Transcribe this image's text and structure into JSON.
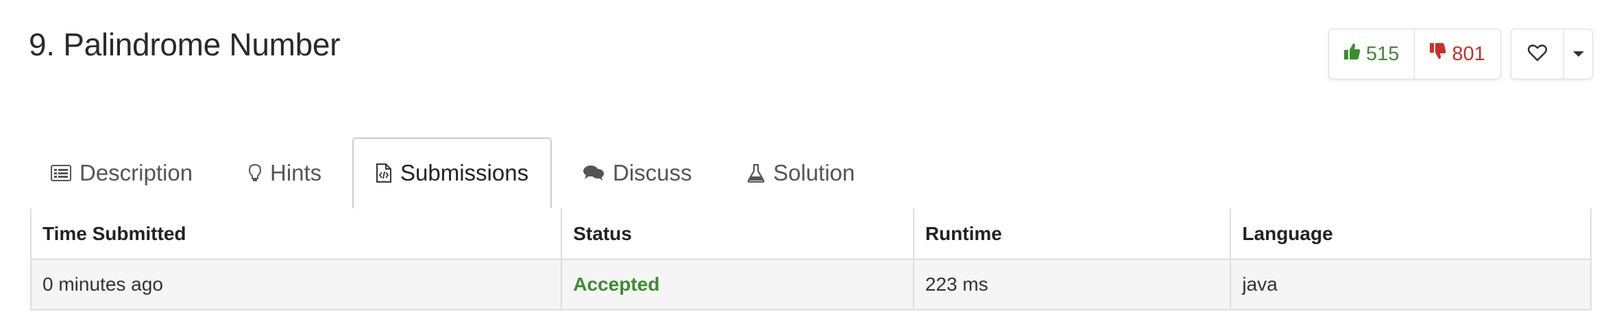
{
  "problem": {
    "title": "9. Palindrome Number"
  },
  "votes": {
    "likes": "515",
    "dislikes": "801"
  },
  "tabs": [
    {
      "label": "Description",
      "icon": "description-icon"
    },
    {
      "label": "Hints",
      "icon": "lightbulb-icon"
    },
    {
      "label": "Submissions",
      "icon": "code-file-icon",
      "active": true
    },
    {
      "label": "Discuss",
      "icon": "chat-bubbles-icon"
    },
    {
      "label": "Solution",
      "icon": "flask-icon"
    }
  ],
  "table": {
    "headers": [
      "Time Submitted",
      "Status",
      "Runtime",
      "Language"
    ],
    "rows": [
      {
        "time": "0 minutes ago",
        "status": "Accepted",
        "runtime": "223 ms",
        "language": "java"
      }
    ]
  },
  "colors": {
    "accepted": "#3c8d2f",
    "dislike": "#c9302c",
    "like": "#3c8d2f"
  }
}
